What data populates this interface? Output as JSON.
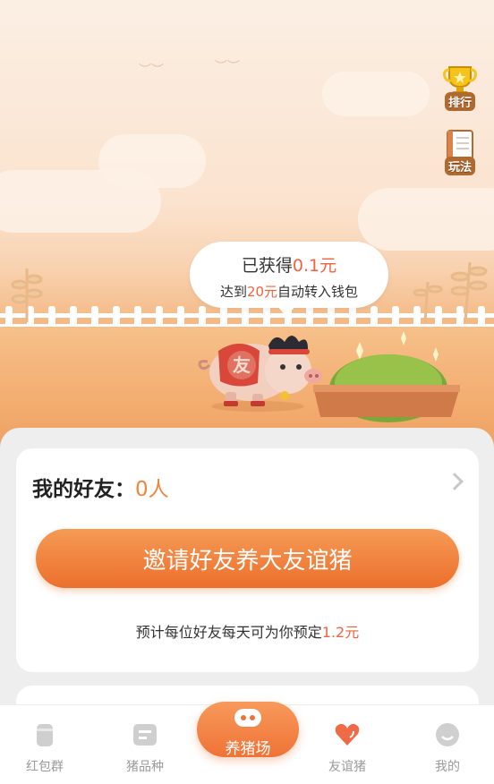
{
  "side": {
    "rank_label": "排行",
    "rules_label": "玩法"
  },
  "bubble": {
    "earned_prefix": "已获得",
    "earned_value": "0.1元",
    "goal_prefix": "达到",
    "goal_value": "20元",
    "goal_suffix": "自动转入钱包"
  },
  "pig_badge": "友",
  "friends": {
    "label": "我的好友：",
    "count": "0人"
  },
  "invite_button": "邀请好友养大友谊猪",
  "estimate": {
    "text": "预计每位好友每天可为你预定",
    "value": "1.2元"
  },
  "tabs": [
    {
      "label": "红包群",
      "icon": "cup-icon"
    },
    {
      "label": "猪品种",
      "icon": "card-icon"
    },
    {
      "label": "养猪场",
      "icon": "pig-face-icon"
    },
    {
      "label": "友谊猪",
      "icon": "heart-icon"
    },
    {
      "label": "我的",
      "icon": "smile-icon"
    }
  ],
  "colors": {
    "accent": "#ec6f2c",
    "highlight": "#f0633c",
    "count": "#f0863a"
  }
}
